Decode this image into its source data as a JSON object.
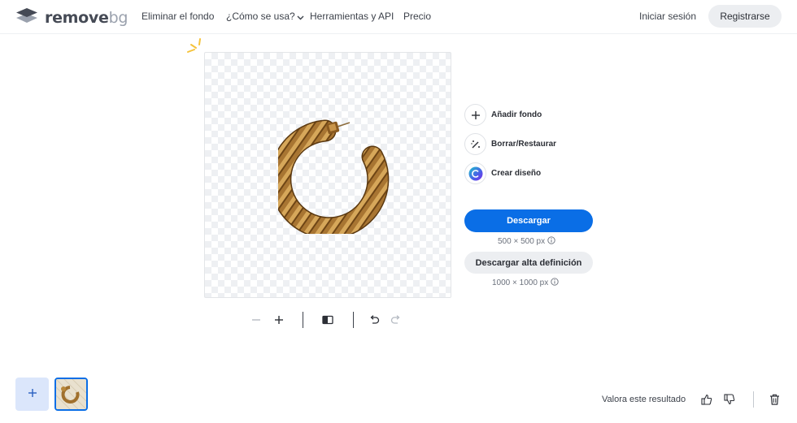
{
  "header": {
    "logo": {
      "icon": "layers-logo-icon",
      "word_main": "remove",
      "word_accent": "bg"
    },
    "nav": [
      {
        "label": "Eliminar el fondo"
      },
      {
        "label": "¿Cómo se usa?",
        "icon": "chevron-down-icon"
      },
      {
        "label": "Herramientas y API"
      },
      {
        "label": "Precio"
      }
    ],
    "login_label": "Iniciar sesión",
    "register_label": "Registrarse"
  },
  "canvas": {
    "background": "transparent-checkerboard",
    "subject": "gold-twisted-hoop-earring"
  },
  "toolbar": {
    "icons": [
      "zoom-out-icon",
      "zoom-in-icon",
      "compare-icon",
      "undo-icon",
      "redo-icon"
    ]
  },
  "actions": [
    {
      "label": "Añadir fondo",
      "icon": "plus-icon"
    },
    {
      "label": "Borrar/Restaurar",
      "icon": "magic-brush-icon"
    },
    {
      "label": "Crear diseño",
      "icon": "canva-icon"
    }
  ],
  "download": {
    "label": "Descargar",
    "size": "500 × 500 px",
    "hd_label": "Descargar alta definición",
    "hd_size": "1000 × 1000 px"
  },
  "bottom": {
    "rate_label": "Valora este resultado",
    "icons": [
      "add-image-icon",
      "thumbs-up-icon",
      "thumbs-down-icon",
      "trash-icon"
    ]
  },
  "colors": {
    "primary": "#0a6ee6",
    "secondary_button": "#eceef1",
    "add_tile": "#dbe6fb",
    "sparkle": "#f5c33b",
    "earring_gold": "#b8873a"
  }
}
